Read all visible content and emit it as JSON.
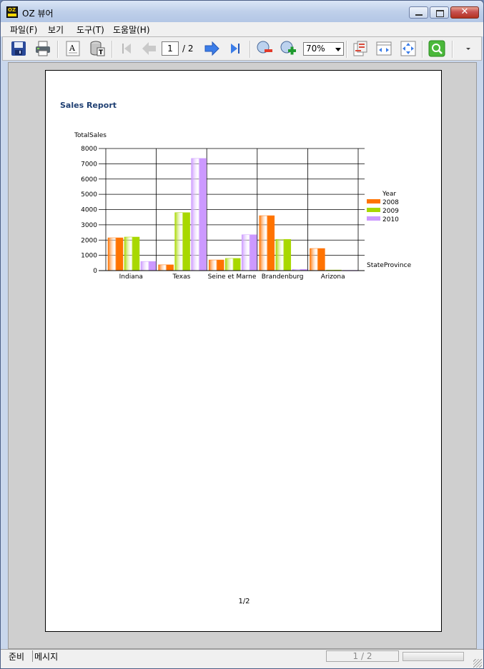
{
  "window": {
    "title": "OZ 뷰어"
  },
  "menu": [
    {
      "label": "파일(F)"
    },
    {
      "label": "보기"
    },
    {
      "label": "도구(T)"
    },
    {
      "label": "도움말(H)"
    }
  ],
  "toolbar": {
    "current_page": "1",
    "page_total": "/ 2",
    "zoom": "70%",
    "icons": [
      "save-icon",
      "print-icon",
      "text-export-icon",
      "database-icon",
      "first-page-icon",
      "previous-page-icon",
      "next-page-icon",
      "last-page-icon",
      "zoom-out-icon",
      "zoom-in-icon",
      "page-setup-icon",
      "fit-width-icon",
      "fit-page-icon",
      "search-icon"
    ]
  },
  "report": {
    "title": "Sales Report",
    "footer": "1/2"
  },
  "chart_data": {
    "type": "bar",
    "ylabel": "TotalSales",
    "xlabel": "StateProvince",
    "legend_title": "Year",
    "legend_position": "right",
    "categories": [
      "Indiana",
      "Texas",
      "Seine et Marne",
      "Brandenburg",
      "Arizona"
    ],
    "ylim": [
      0,
      8000
    ],
    "yticks": [
      "0",
      "1000",
      "2000",
      "3000",
      "4000",
      "5000",
      "6000",
      "7000",
      "8000"
    ],
    "series": [
      {
        "name": "2008",
        "values": [
          2150,
          380,
          700,
          3600,
          1450
        ],
        "color": "#ff7300"
      },
      {
        "name": "2009",
        "values": [
          2200,
          3800,
          800,
          2050,
          40
        ],
        "color": "#a8d800"
      },
      {
        "name": "2010",
        "values": [
          600,
          7350,
          2350,
          80,
          20
        ],
        "color": "#cc99ff"
      }
    ],
    "grid": true
  },
  "status": {
    "state": "준비",
    "message": "메시지",
    "pages": "1 / 2"
  }
}
